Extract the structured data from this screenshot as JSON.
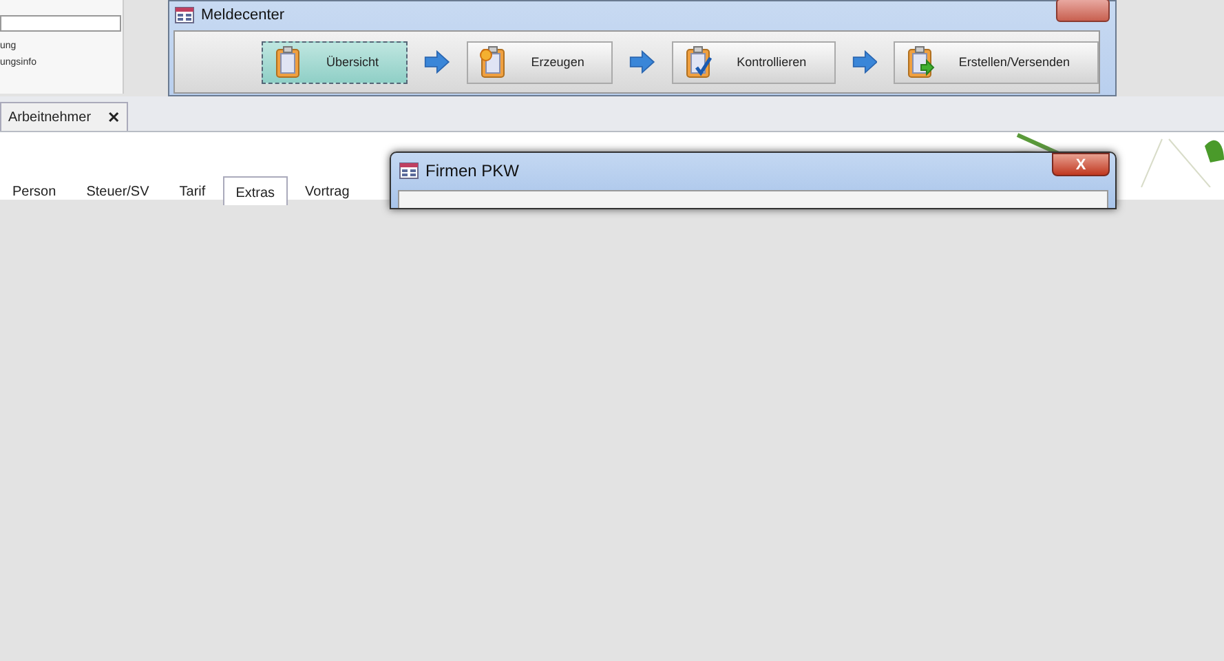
{
  "left_panel": {
    "items": [
      "ung",
      "ungsinfo"
    ]
  },
  "meldecenter": {
    "title": "Meldecenter",
    "steps": [
      {
        "label": "Übersicht",
        "kind": "overview",
        "selected": true
      },
      {
        "label": "Erzeugen",
        "kind": "create",
        "selected": false
      },
      {
        "label": "Kontrollieren",
        "kind": "check",
        "selected": false
      },
      {
        "label": "Erstellen/Versenden",
        "kind": "send",
        "selected": false
      }
    ]
  },
  "document_tabs": [
    {
      "label": "Arbeitnehmer",
      "close": "✕"
    }
  ],
  "form_tabs": [
    {
      "label": "Person",
      "selected": false
    },
    {
      "label": "Steuer/SV",
      "selected": false
    },
    {
      "label": "Tarif",
      "selected": false
    },
    {
      "label": "Extras",
      "selected": true
    },
    {
      "label": "Vortrag",
      "selected": false
    }
  ],
  "dialog": {
    "title": "Firmen PKW",
    "close": "X"
  }
}
